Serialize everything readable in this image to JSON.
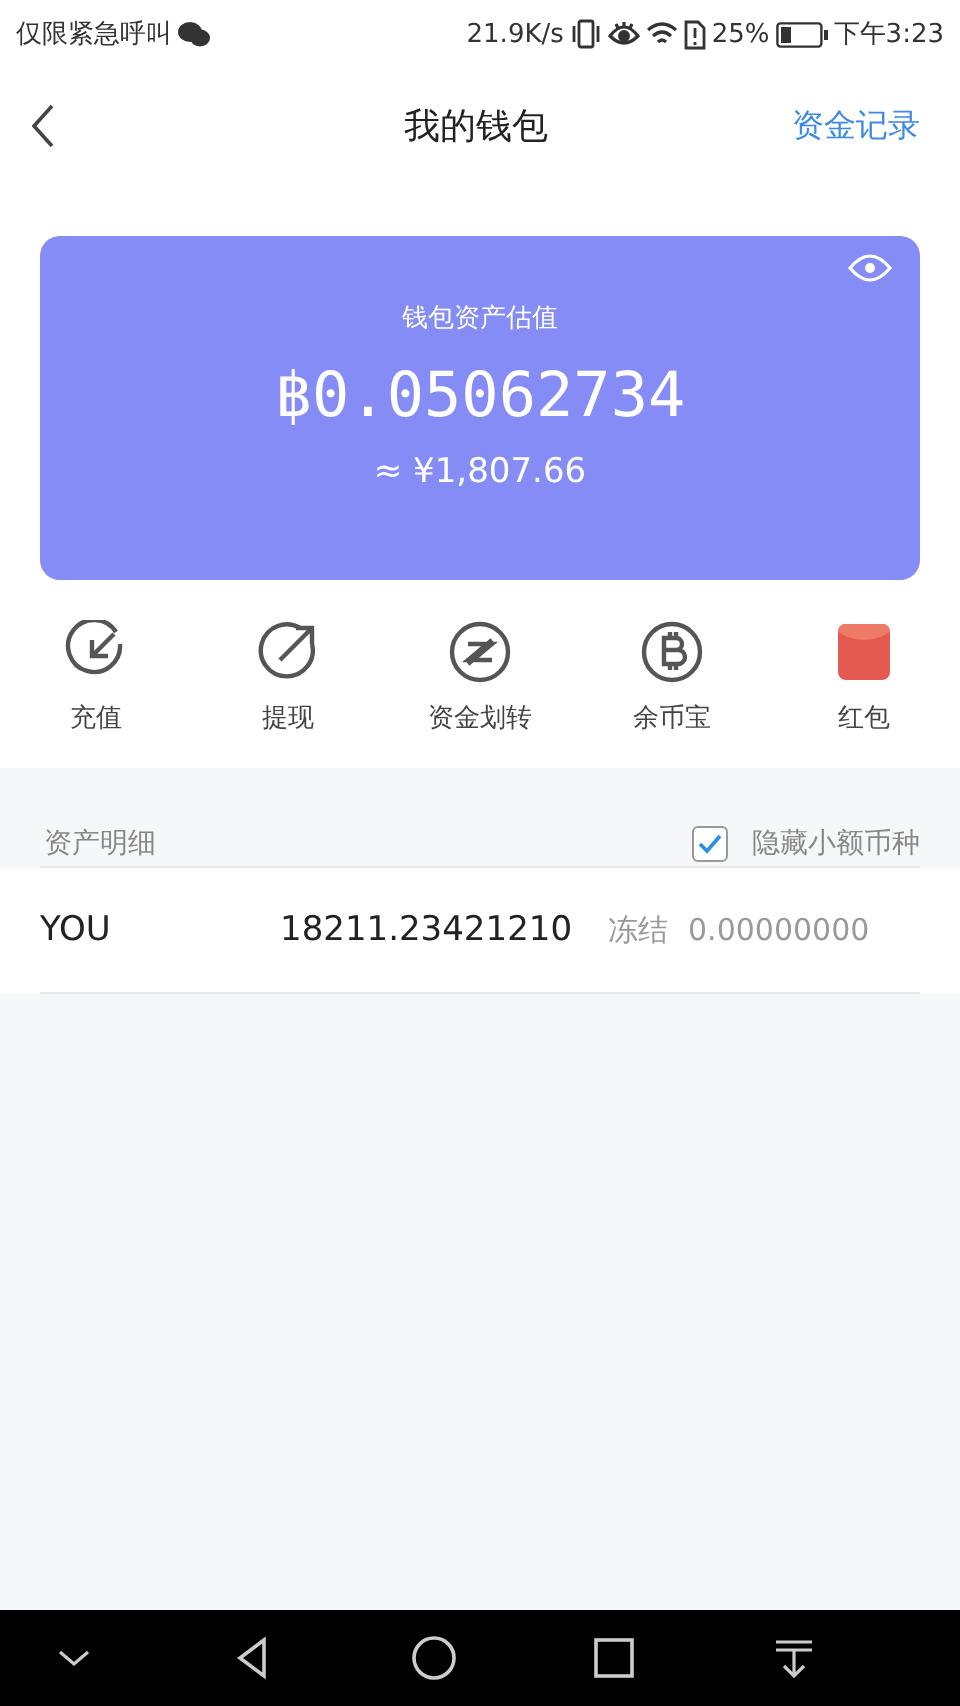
{
  "status_bar": {
    "carrier": "仅限紧急呼叫",
    "speed": "21.9K/s",
    "battery": "25%",
    "time": "下午3:23"
  },
  "header": {
    "title": "我的钱包",
    "action": "资金记录"
  },
  "balance_card": {
    "visible": true,
    "label": "钱包资产估值",
    "amount": "฿0.05062734",
    "fiat": "≈ ¥1,807.66"
  },
  "actions": [
    {
      "kind": "deposit",
      "label": "充值"
    },
    {
      "kind": "withdraw",
      "label": "提现"
    },
    {
      "kind": "transfer",
      "label": "资金划转"
    },
    {
      "kind": "coin",
      "label": "余币宝"
    },
    {
      "kind": "redpacket",
      "label": "红包"
    }
  ],
  "assets": {
    "title": "资产明细",
    "hide_small": {
      "label": "隐藏小额币种",
      "checked": true
    },
    "rows": [
      {
        "coin": "YOU",
        "amount": "18211.23421210",
        "frozen_label": "冻结",
        "frozen": "0.00000000"
      }
    ]
  }
}
